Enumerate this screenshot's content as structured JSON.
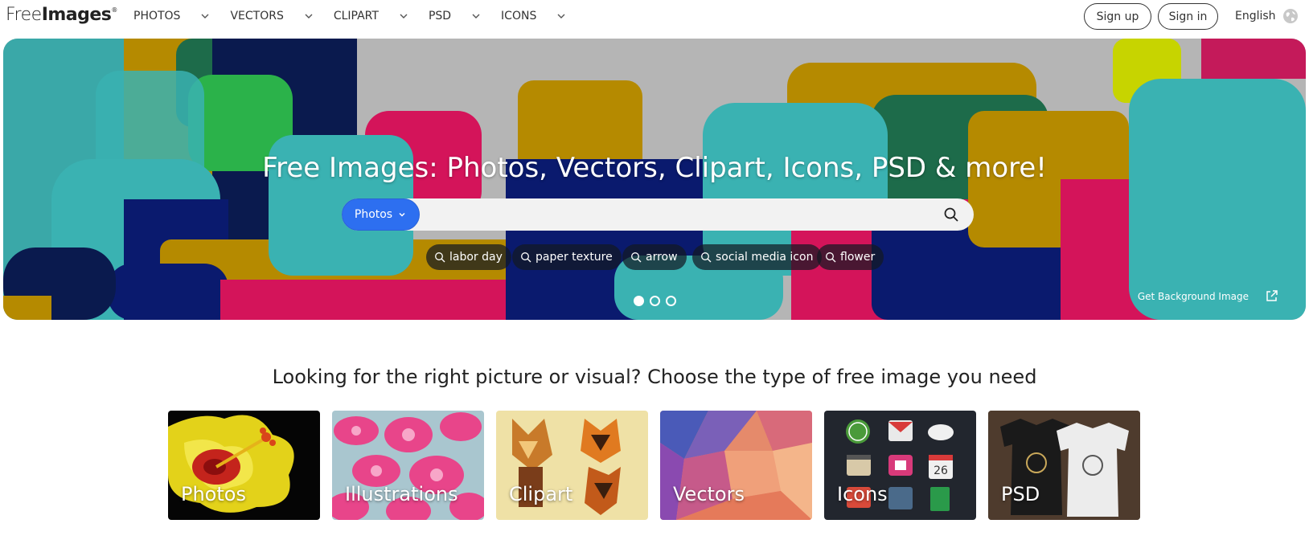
{
  "header": {
    "logo_light": "Free",
    "logo_bold": "Images",
    "logo_mark": "®",
    "nav": [
      {
        "label": "PHOTOS",
        "icon": "chevron-down-icon"
      },
      {
        "label": "VECTORS",
        "icon": "chevron-down-icon"
      },
      {
        "label": "CLIPART",
        "icon": "chevron-down-icon"
      },
      {
        "label": "PSD",
        "icon": "chevron-down-icon"
      },
      {
        "label": "ICONS",
        "icon": "chevron-down-icon"
      }
    ],
    "signup_label": "Sign up",
    "signin_label": "Sign in",
    "language": "English",
    "language_icon": "globe-icon"
  },
  "hero": {
    "title": "Free Images: Photos, Vectors, Clipart, Icons, PSD & more!",
    "search": {
      "type_label": "Photos",
      "placeholder": "",
      "value": "",
      "button_icon": "search-icon"
    },
    "tags": [
      "labor day",
      "paper texture",
      "arrow",
      "social media icon",
      "flower"
    ],
    "slides": {
      "count": 3,
      "active": 1
    },
    "background_link": "Get Background Image",
    "background_link_icon": "external-link-icon"
  },
  "categories": {
    "heading": "Looking for the right picture or visual? Choose the type of free image you need",
    "items": [
      {
        "label": "Photos"
      },
      {
        "label": "Illustrations"
      },
      {
        "label": "Clipart"
      },
      {
        "label": "Vectors"
      },
      {
        "label": "Icons"
      },
      {
        "label": "PSD"
      }
    ]
  },
  "colors": {
    "accent": "#2d6ff0",
    "teal": "#3ab2b2",
    "navy": "#0a1a6e",
    "magenta": "#d4145a",
    "mustard": "#b58a00",
    "green": "#1d6b4a"
  }
}
